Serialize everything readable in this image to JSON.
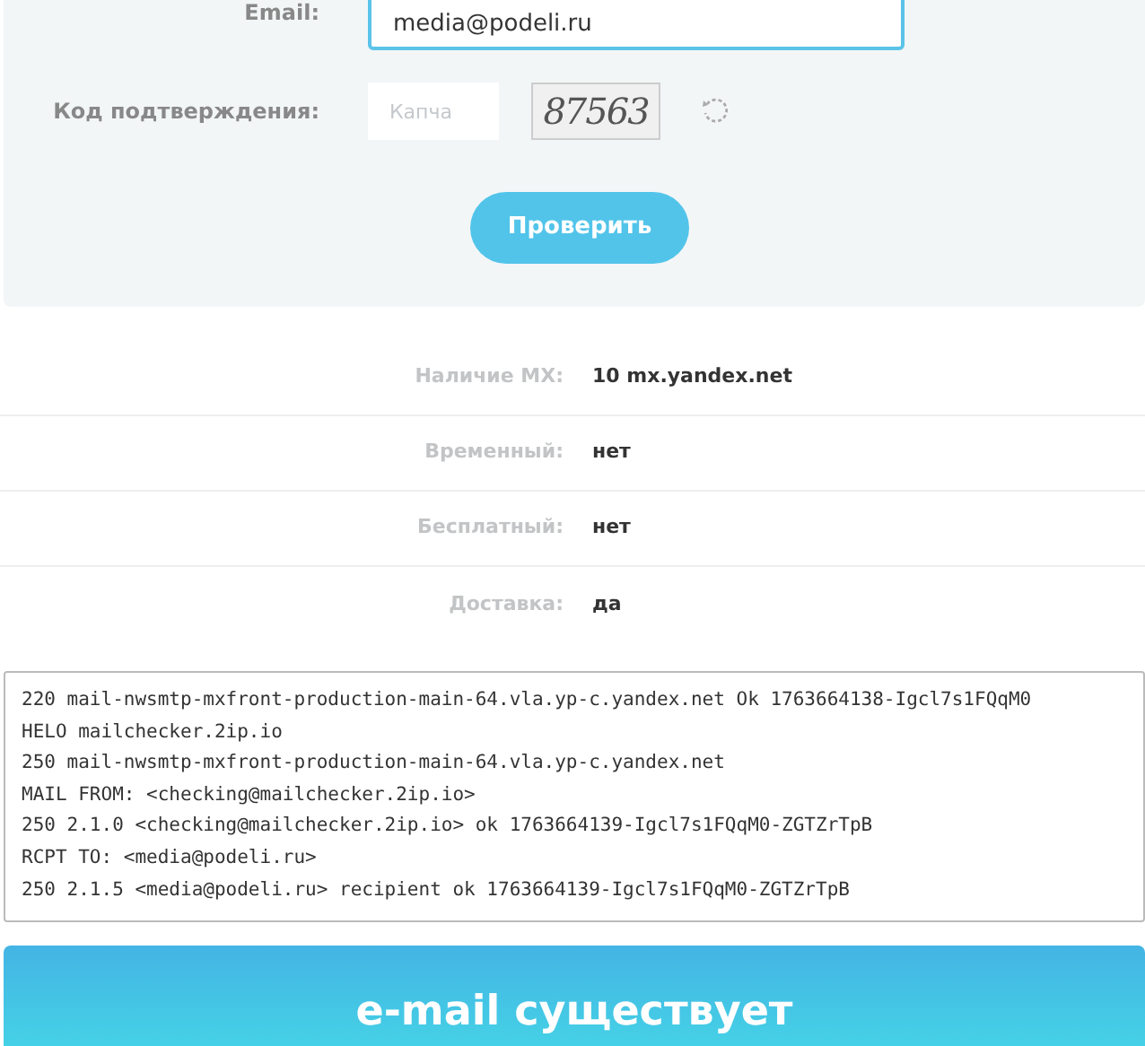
{
  "form": {
    "email": {
      "label": "Email:",
      "value": "media@podeli.ru"
    },
    "captcha": {
      "label": "Код подтверждения:",
      "placeholder": "Капча",
      "image_text": "87563"
    },
    "submit": "Проверить"
  },
  "results": [
    {
      "label": "Наличие MX:",
      "value": "10 mx.yandex.net"
    },
    {
      "label": "Временный:",
      "value": "нет"
    },
    {
      "label": "Бесплатный:",
      "value": "нет"
    },
    {
      "label": "Доставка:",
      "value": "да"
    }
  ],
  "log": [
    "220 mail-nwsmtp-mxfront-production-main-64.vla.yp-c.yandex.net Ok 1763664138-Igcl7s1FQqM0",
    "HELO mailchecker.2ip.io",
    "250 mail-nwsmtp-mxfront-production-main-64.vla.yp-c.yandex.net",
    "MAIL FROM: <checking@mailchecker.2ip.io>",
    "250 2.1.0 <checking@mailchecker.2ip.io> ok 1763664139-Igcl7s1FQqM0-ZGTZrTpB",
    "RCPT TO: <media@podeli.ru>",
    "250 2.1.5 <media@podeli.ru> recipient ok 1763664139-Igcl7s1FQqM0-ZGTZrTpB"
  ],
  "verdict": "e-mail существует"
}
